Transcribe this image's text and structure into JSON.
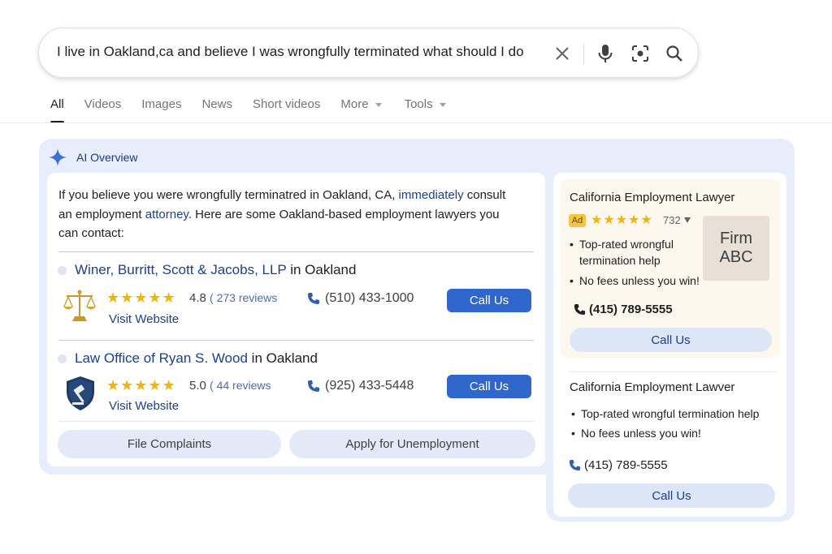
{
  "search": {
    "query": "I live in Oakland,ca and believe I was wrongfully terminated what should I do"
  },
  "icons": {
    "clear": "close-icon",
    "voice": "microphone-icon",
    "lens": "lens-icon",
    "search": "search-icon"
  },
  "tabs": [
    {
      "label": "All",
      "active": true
    },
    {
      "label": "Videos"
    },
    {
      "label": "Images"
    },
    {
      "label": "News"
    },
    {
      "label": "Short videos"
    },
    {
      "label": "More",
      "dropdown": true
    },
    {
      "label": "Tools",
      "dropdown": true
    }
  ],
  "ai_overview": {
    "title": "AI Overview",
    "intro": {
      "part1": "If you believe you were wrongfully terminatred in Oakland, CA, ",
      "link1": "immediately",
      "part2": " consult an employment ",
      "link2": "attorney",
      "part3": ". Here are some Oakland-based employment lawyers you can contact:"
    },
    "firms": [
      {
        "name": "Winer, Burritt, Scott & Jacobs, LLP",
        "location": " in Oakland",
        "rating": "4.8",
        "reviews": "( 273 reviews",
        "visit": "Visit Website",
        "phone": "(510) 433-1000",
        "call": "Call Us",
        "icon": "scales-of-justice-icon"
      },
      {
        "name": "Law Office of Ryan S. Wood",
        "location": " in Oakland",
        "rating": "5.0",
        "reviews": "( 44 reviews",
        "visit": "Visit Website",
        "phone": "(925) 433-5448",
        "call": "Call Us",
        "icon": "shield-gavel-icon"
      }
    ],
    "actions": {
      "complaints": "File Complaints",
      "unemployment": "Apply for Unemployment"
    }
  },
  "ads": [
    {
      "title": "California Employment Lawyer",
      "badge": "Ad",
      "count": "732",
      "logo_line1": "Firm",
      "logo_line2": "ABC",
      "bullet1_a": "Top-rated wrongful",
      "bullet1_b": "termination help",
      "bullet2": "No fees unless you win!",
      "phone": "(415) 789-5555",
      "call": "Call Us"
    },
    {
      "title": "California Employment Lawver",
      "bullet1": "Top-rated wrongful termination help",
      "bullet2": "No fees unless you win!",
      "phone": "(415) 789-5555",
      "call": "Call Us"
    }
  ],
  "colors": {
    "accent": "#2f67cc",
    "link": "#1a3f8f",
    "star": "#f4b400",
    "panel": "#e8edfb",
    "ad_background": "#fdf8ed"
  }
}
